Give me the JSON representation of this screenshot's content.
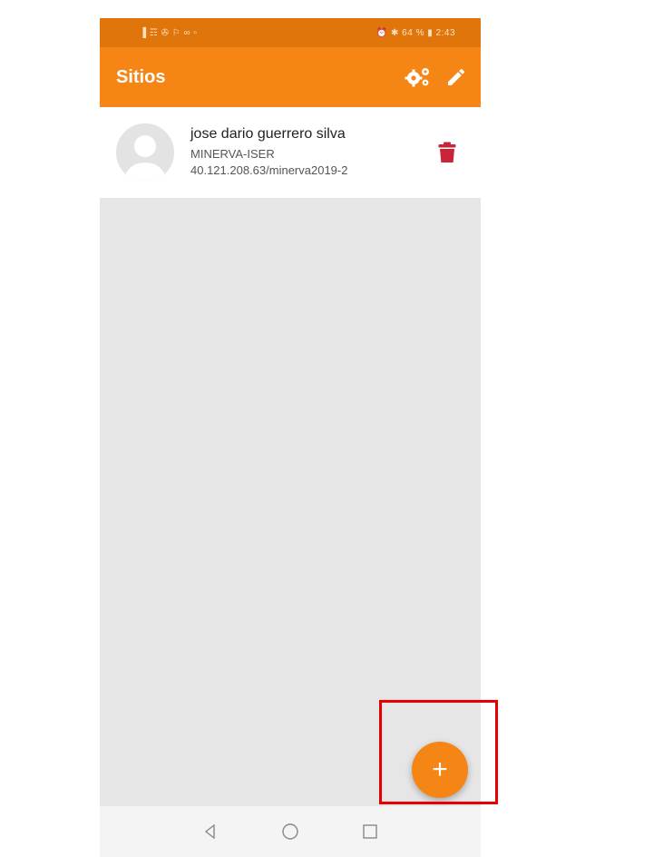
{
  "status_bar": {
    "left_icons": "▐ ☶ ✇ ⚐ ∞ ▫",
    "right_text": "⏰ ✱ 64 % ▮ 2:43"
  },
  "app_bar": {
    "title": "Sitios",
    "settings_icon": "gears-icon",
    "edit_icon": "pencil-icon"
  },
  "sites": [
    {
      "name": "jose dario guerrero silva",
      "site": "MINERVA-ISER",
      "url": "40.121.208.63/minerva2019-2"
    }
  ],
  "fab": {
    "label": "+"
  },
  "colors": {
    "primary": "#f58514",
    "status_bar": "#e0760b",
    "delete": "#c8243a",
    "highlight": "#e80000"
  }
}
